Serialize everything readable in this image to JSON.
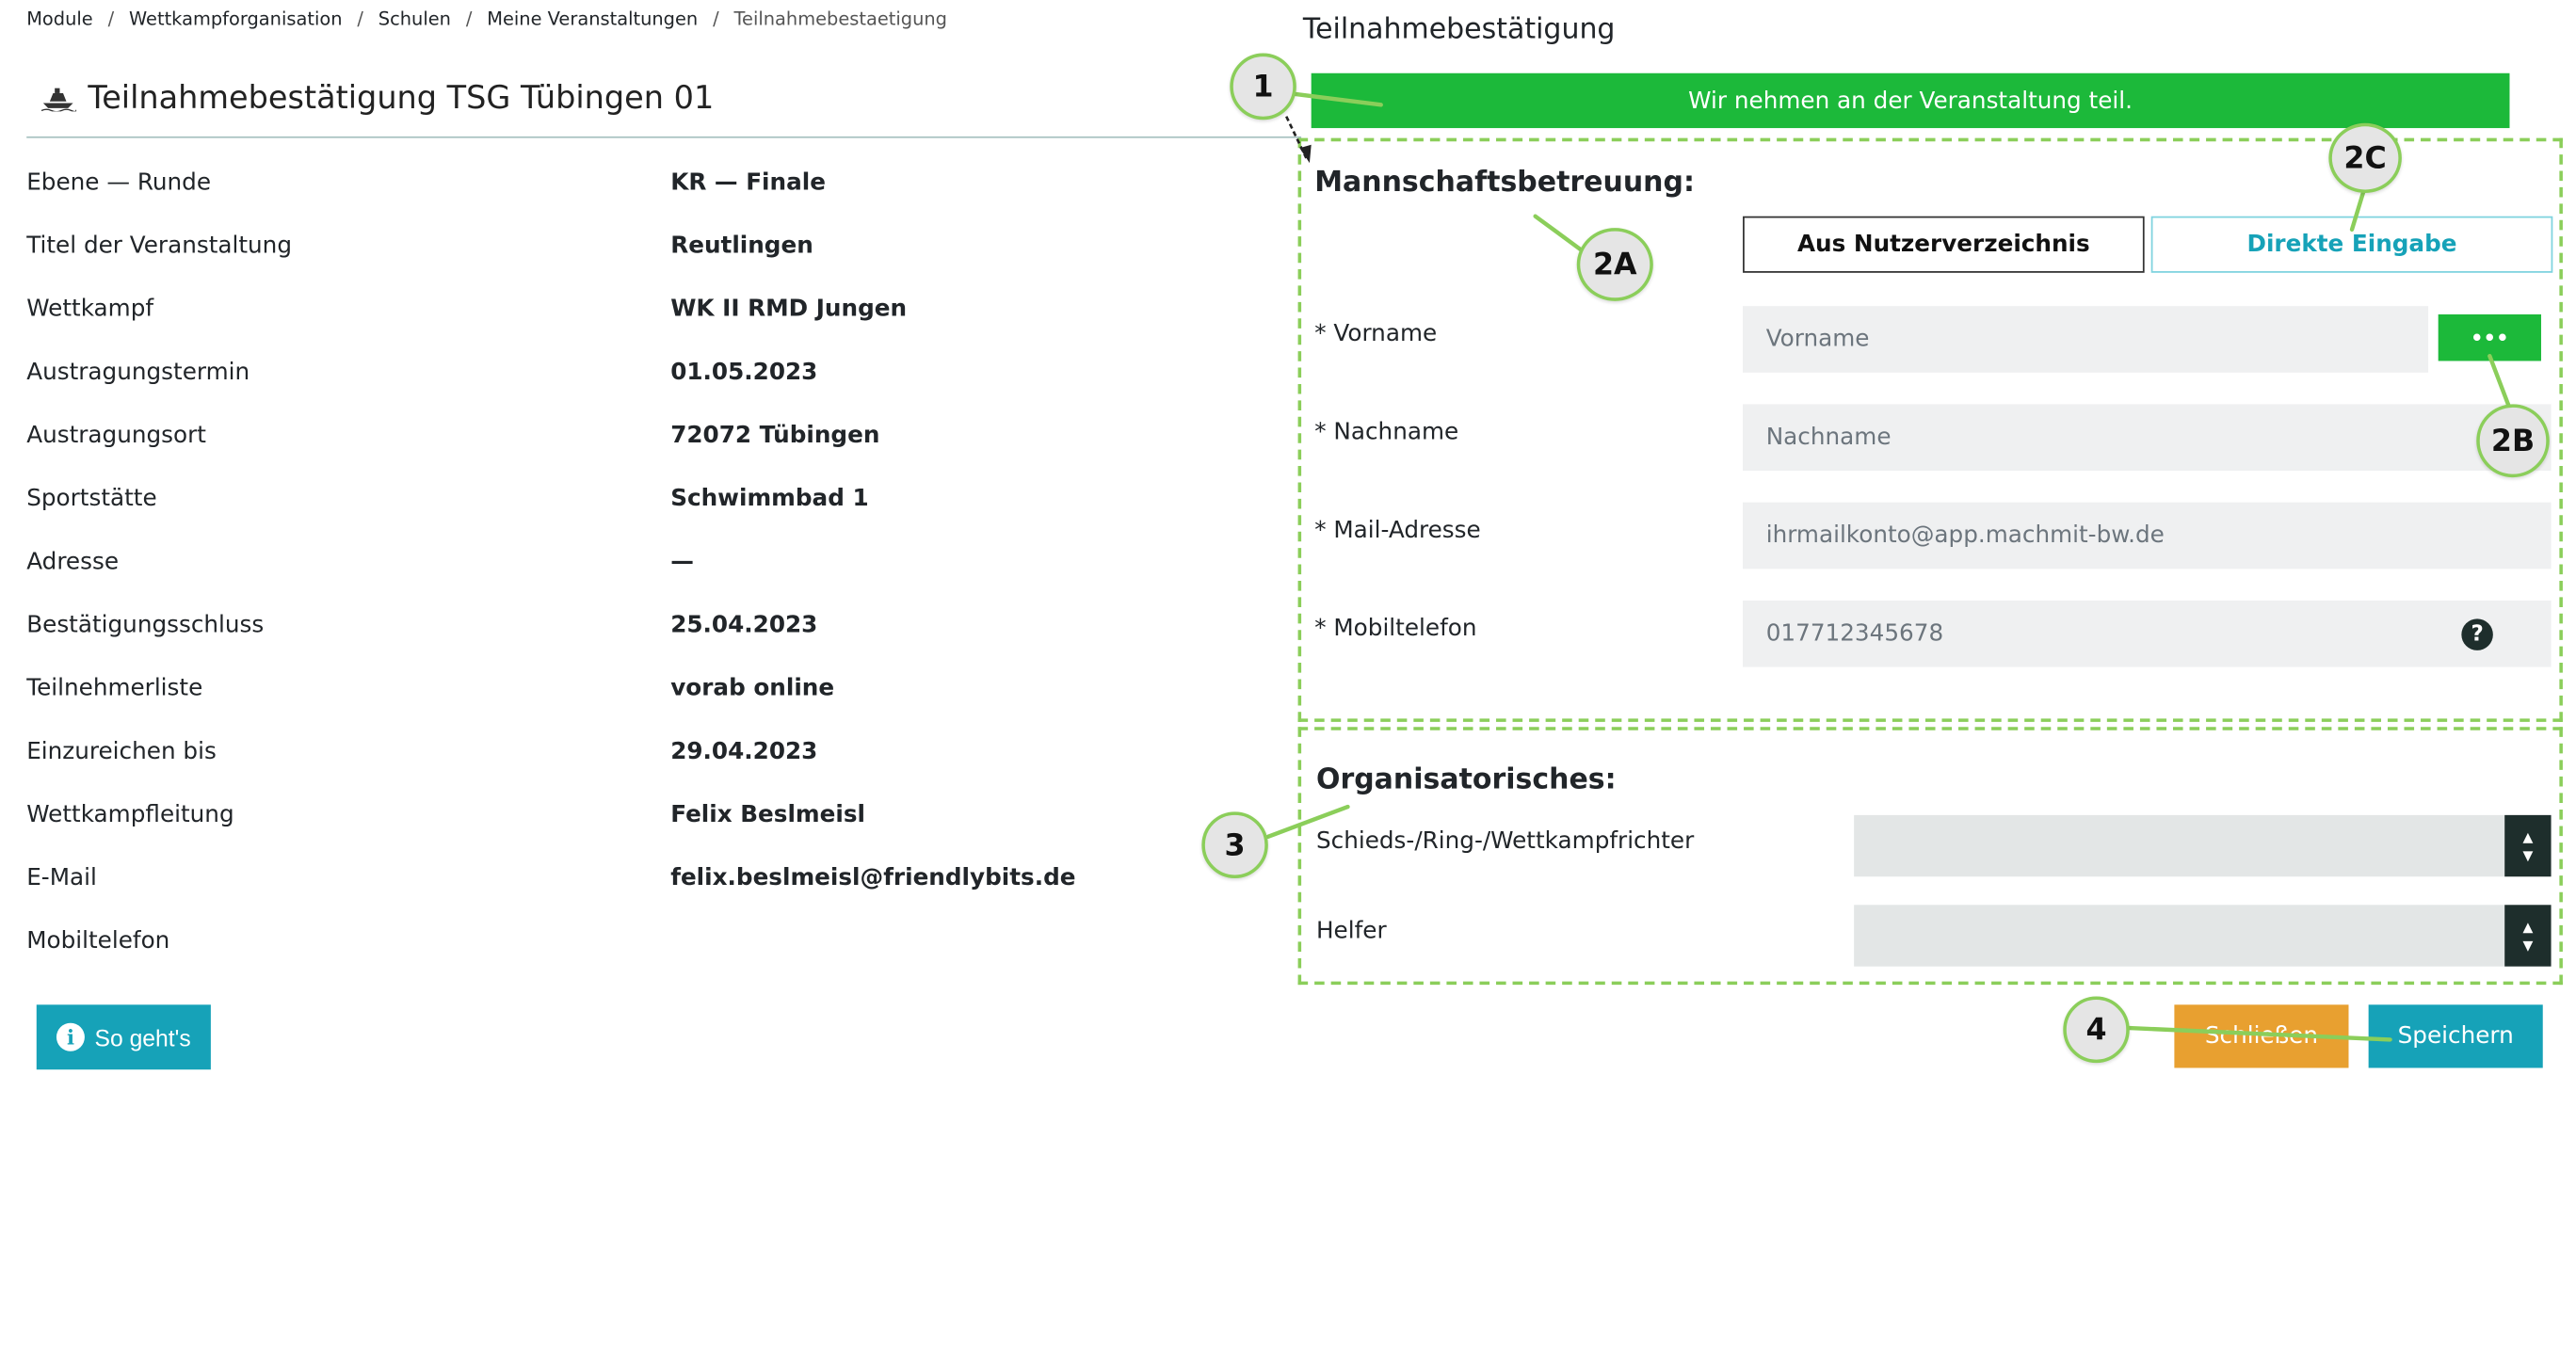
{
  "breadcrumb": [
    "Module",
    "Wettkampforganisation",
    "Schulen",
    "Meine Veranstaltungen"
  ],
  "breadcrumb_current": "Teilnahmebestaetigung",
  "breadcrumb_separator": "/",
  "page_title": "Teilnahmebestätigung TSG Tübingen 01",
  "details": [
    {
      "label": "Ebene — Runde",
      "value": "KR — Finale"
    },
    {
      "label": "Titel der Veranstaltung",
      "value": "Reutlingen"
    },
    {
      "label": "Wettkampf",
      "value": "WK II RMD Jungen"
    },
    {
      "label": "Austragungstermin",
      "value": "01.05.2023"
    },
    {
      "label": "Austragungsort",
      "value": "72072 Tübingen"
    },
    {
      "label": "Sportstätte",
      "value": "Schwimmbad 1"
    },
    {
      "label": "Adresse",
      "value": "—"
    },
    {
      "label": "Bestätigungsschluss",
      "value": "25.04.2023"
    },
    {
      "label": "Teilnehmerliste",
      "value": "vorab online"
    },
    {
      "label": "Einzureichen bis",
      "value": "29.04.2023"
    },
    {
      "label": "Wettkampfleitung",
      "value": "Felix Beslmeisl"
    },
    {
      "label": "E-Mail",
      "value": "felix.beslmeisl@friendlybits.de"
    },
    {
      "label": "Mobiltelefon",
      "value": ""
    }
  ],
  "howto_button": "So geht's",
  "form": {
    "title": "Teilnahmebestätigung",
    "confirm_button": "Wir nehmen an der Veranstaltung teil.",
    "team_support": {
      "heading": "Mannschaftsbetreuung:",
      "toggle_directory": "Aus Nutzerverzeichnis",
      "toggle_direct": "Direkte Eingabe",
      "firstname_label": "* Vorname",
      "firstname_placeholder": "Vorname",
      "lastname_label": "* Nachname",
      "lastname_placeholder": "Nachname",
      "mail_label": "* Mail-Adresse",
      "mail_placeholder": "ihrmailkonto@app.machmit-bw.de",
      "mobile_label": "* Mobiltelefon",
      "mobile_placeholder": "017712345678",
      "more_button": "•••",
      "help_icon": "?"
    },
    "organisational": {
      "heading": "Organisatorisches:",
      "referee_label": "Schieds-/Ring-/Wettkampfrichter",
      "helper_label": "Helfer",
      "spinner_up": "▲",
      "spinner_down": "▼"
    },
    "close_button": "Schließen",
    "save_button": "Speichern"
  },
  "callouts": [
    "1",
    "2A",
    "2B",
    "2C",
    "3",
    "4"
  ],
  "colors": {
    "confirm_green": "#1cb93a",
    "accent_teal": "#16a2b8",
    "close_orange": "#e8a030",
    "callout_border": "#8bce5a",
    "dark_spinner": "#1e2e2c"
  },
  "icons": {
    "title_icon": "ship-icon",
    "howto_icon": "info-icon",
    "help_icon": "question-circle-icon"
  }
}
